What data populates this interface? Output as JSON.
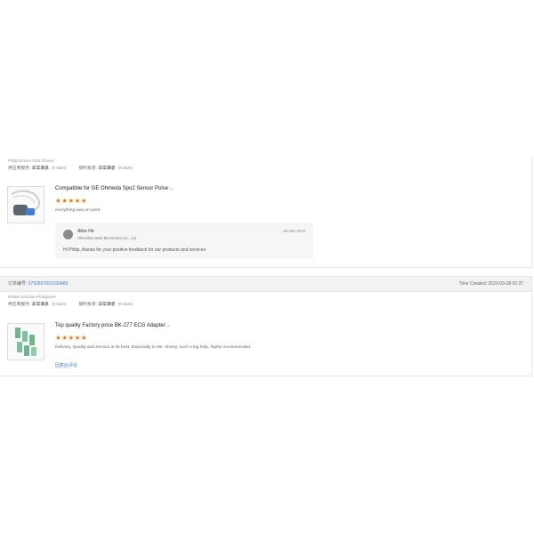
{
  "review1": {
    "buyer": "Philip Brown-Gdol-Ghana",
    "rating1_label": "供应商服务:",
    "rating1_value": "非常满意",
    "rating1_stars": "(5 stars)",
    "rating2_label": "按时发货:",
    "rating2_value": "非常满意",
    "rating2_stars": "(5 stars)",
    "product_title": "Compatible for GE Ohmeda Spo2 Sensor Pulse ..",
    "stars": "★★★★★",
    "rating": 5,
    "review_text": "everything was on point",
    "reply": {
      "name": "Alice He",
      "company": "Shenzhen Best Electronics Co., Ltd",
      "date": "28 Mar 2023",
      "message": "Hi Philip, thanks for your positive feedback for our products and services"
    }
  },
  "order2": {
    "order_label": "订单编号:",
    "order_number": "9792837001033489",
    "time_created": "Time Created: 2023-03-28 02:37"
  },
  "review2": {
    "buyer": "Rafael Sambile-Philippines",
    "rating1_label": "供应商服务:",
    "rating1_value": "非常满意",
    "rating1_stars": "(5 stars)",
    "rating2_label": "按时发货:",
    "rating2_value": "非常满意",
    "rating2_stars": "(5 stars)",
    "product_title": "Top quality Factory price BK-277 ECG Adapter ..",
    "stars": "★★★★★",
    "rating": 5,
    "review_text": "Delivery, Quality and Service at its best. Especially to Ms. Sherry, such a big help, highly recommended.",
    "reply_link": "回复此评论"
  },
  "colors": {
    "star": "#f07c10",
    "link": "#3f7fd6"
  }
}
